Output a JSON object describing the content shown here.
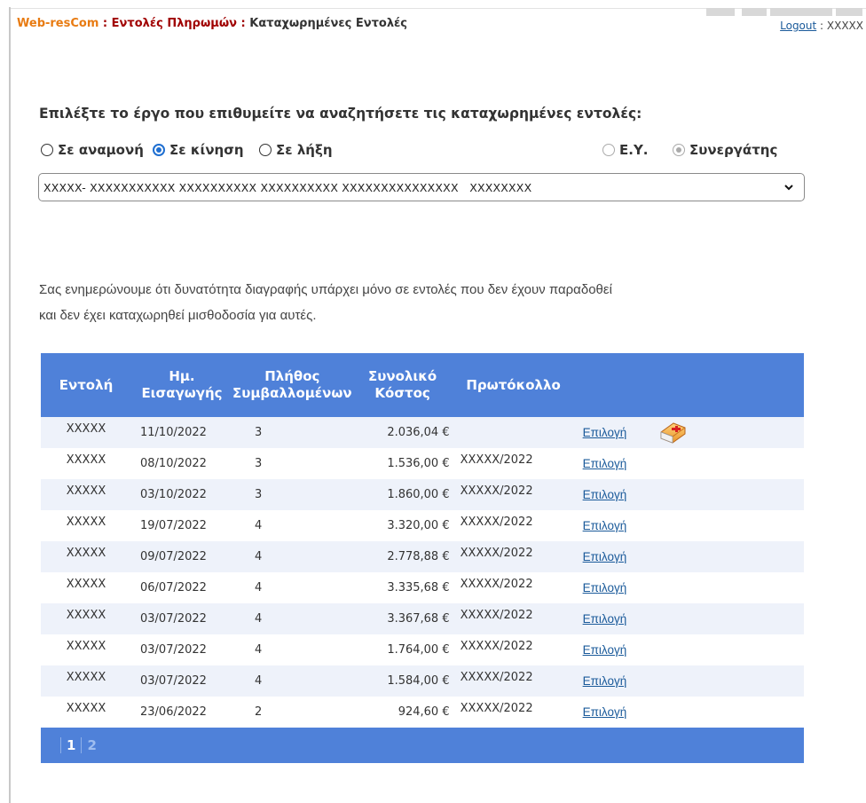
{
  "header": {
    "home": "Web-resCom",
    "sep1": " : ",
    "crumb1": "Εντολές Πληρωμών",
    "sep2": " : ",
    "crumb2": "Καταχωρημένες Εντολές",
    "logout_label": "Logout",
    "user_sep": " : ",
    "username": "XXXXX"
  },
  "form": {
    "prompt": "Επιλέξτε το έργο που επιθυμείτε να αναζητήσετε τις καταχωρημένες εντολές:",
    "status_options": [
      {
        "label": "Σε αναμονή",
        "checked": false
      },
      {
        "label": "Σε κίνηση",
        "checked": true
      },
      {
        "label": "Σε λήξη",
        "checked": false
      }
    ],
    "role_options": [
      {
        "label": "Ε.Υ.",
        "checked": false,
        "disabled": true
      },
      {
        "label": "Συνεργάτης",
        "checked": true,
        "disabled": true
      }
    ],
    "project_select": "XXXXX- XXXXXXXXXXX XXXXXXXXXX XXXXXXXXXX XXXXXXXXXXXXXXX   XXXXXXXX"
  },
  "notice": {
    "line1": "Σας ενημερώνουμε ότι δυνατότητα διαγραφής υπάρχει μόνο σε εντολές που δεν έχουν παραδοθεί",
    "line2": "και δεν έχει καταχωρηθεί μισθοδοσία για αυτές."
  },
  "table": {
    "headers": {
      "order": "Εντολή",
      "date_l1": "Ημ.",
      "date_l2": "Εισαγωγής",
      "count_l1": "Πλήθος",
      "count_l2": "Συμβαλλομένων",
      "cost_l1": "Συνολικό",
      "cost_l2": "Κόστος",
      "protocol": "Πρωτόκολλο"
    },
    "rows": [
      {
        "order": "XXXXX",
        "date": "11/10/2022",
        "count": "3",
        "cost": "2.036,04 €",
        "protocol": "",
        "link": "Επιλογή",
        "has_icon": true
      },
      {
        "order": "XXXXX",
        "date": "08/10/2022",
        "count": "3",
        "cost": "1.536,00 €",
        "protocol": "XXXXX/2022",
        "link": "Επιλογή",
        "has_icon": false
      },
      {
        "order": "XXXXX",
        "date": "03/10/2022",
        "count": "3",
        "cost": "1.860,00 €",
        "protocol": "XXXXX/2022",
        "link": "Επιλογή",
        "has_icon": false
      },
      {
        "order": "XXXXX",
        "date": "19/07/2022",
        "count": "4",
        "cost": "3.320,00 €",
        "protocol": "XXXXX/2022",
        "link": "Επιλογή",
        "has_icon": false
      },
      {
        "order": "XXXXX",
        "date": "09/07/2022",
        "count": "4",
        "cost": "2.778,88 €",
        "protocol": "XXXXX/2022",
        "link": "Επιλογή",
        "has_icon": false
      },
      {
        "order": "XXXXX",
        "date": "06/07/2022",
        "count": "4",
        "cost": "3.335,68 €",
        "protocol": "XXXXX/2022",
        "link": "Επιλογή",
        "has_icon": false
      },
      {
        "order": "XXXXX",
        "date": "03/07/2022",
        "count": "4",
        "cost": "3.367,68 €",
        "protocol": "XXXXX/2022",
        "link": "Επιλογή",
        "has_icon": false
      },
      {
        "order": "XXXXX",
        "date": "03/07/2022",
        "count": "4",
        "cost": "1.764,00 €",
        "protocol": "XXXXX/2022",
        "link": "Επιλογή",
        "has_icon": false
      },
      {
        "order": "XXXXX",
        "date": "03/07/2022",
        "count": "4",
        "cost": "1.584,00 €",
        "protocol": "XXXXX/2022",
        "link": "Επιλογή",
        "has_icon": false
      },
      {
        "order": "XXXXX",
        "date": "23/06/2022",
        "count": "2",
        "cost": "924,60 €",
        "protocol": "XXXXX/2022",
        "link": "Επιλογή",
        "has_icon": false
      }
    ],
    "pager": {
      "current": "1",
      "pages": [
        "2"
      ]
    }
  },
  "icons": {
    "medical_kit": "medical-kit-icon",
    "chevron": "chevron-down-icon"
  },
  "colors": {
    "header_blue": "#4f81d9",
    "odd_row": "#eef2fa",
    "link": "#1a5a9a",
    "brand_orange": "#e87b12",
    "breadcrumb_red": "#a00000"
  }
}
